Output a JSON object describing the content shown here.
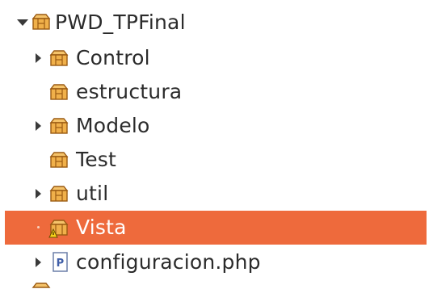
{
  "tree": {
    "root": {
      "label": "PWD_TPFinal",
      "icon": "package-folder-icon",
      "expanded": true
    },
    "items": [
      {
        "label": "Control",
        "icon": "package-folder-icon",
        "expander": "collapsed"
      },
      {
        "label": "estructura",
        "icon": "package-folder-icon",
        "expander": "none"
      },
      {
        "label": "Modelo",
        "icon": "package-folder-icon",
        "expander": "collapsed"
      },
      {
        "label": "Test",
        "icon": "package-folder-icon",
        "expander": "none"
      },
      {
        "label": "util",
        "icon": "package-folder-icon",
        "expander": "collapsed"
      },
      {
        "label": "Vista",
        "icon": "package-folder-warning-icon",
        "expander": "collapsed",
        "selected": true
      },
      {
        "label": "configuracion.php",
        "icon": "php-file-icon",
        "expander": "collapsed"
      }
    ]
  },
  "colors": {
    "selection": "#ee6a3c",
    "text": "#2b2b2b",
    "selected_text": "#ffffff",
    "package_orange": "#d9902a"
  }
}
